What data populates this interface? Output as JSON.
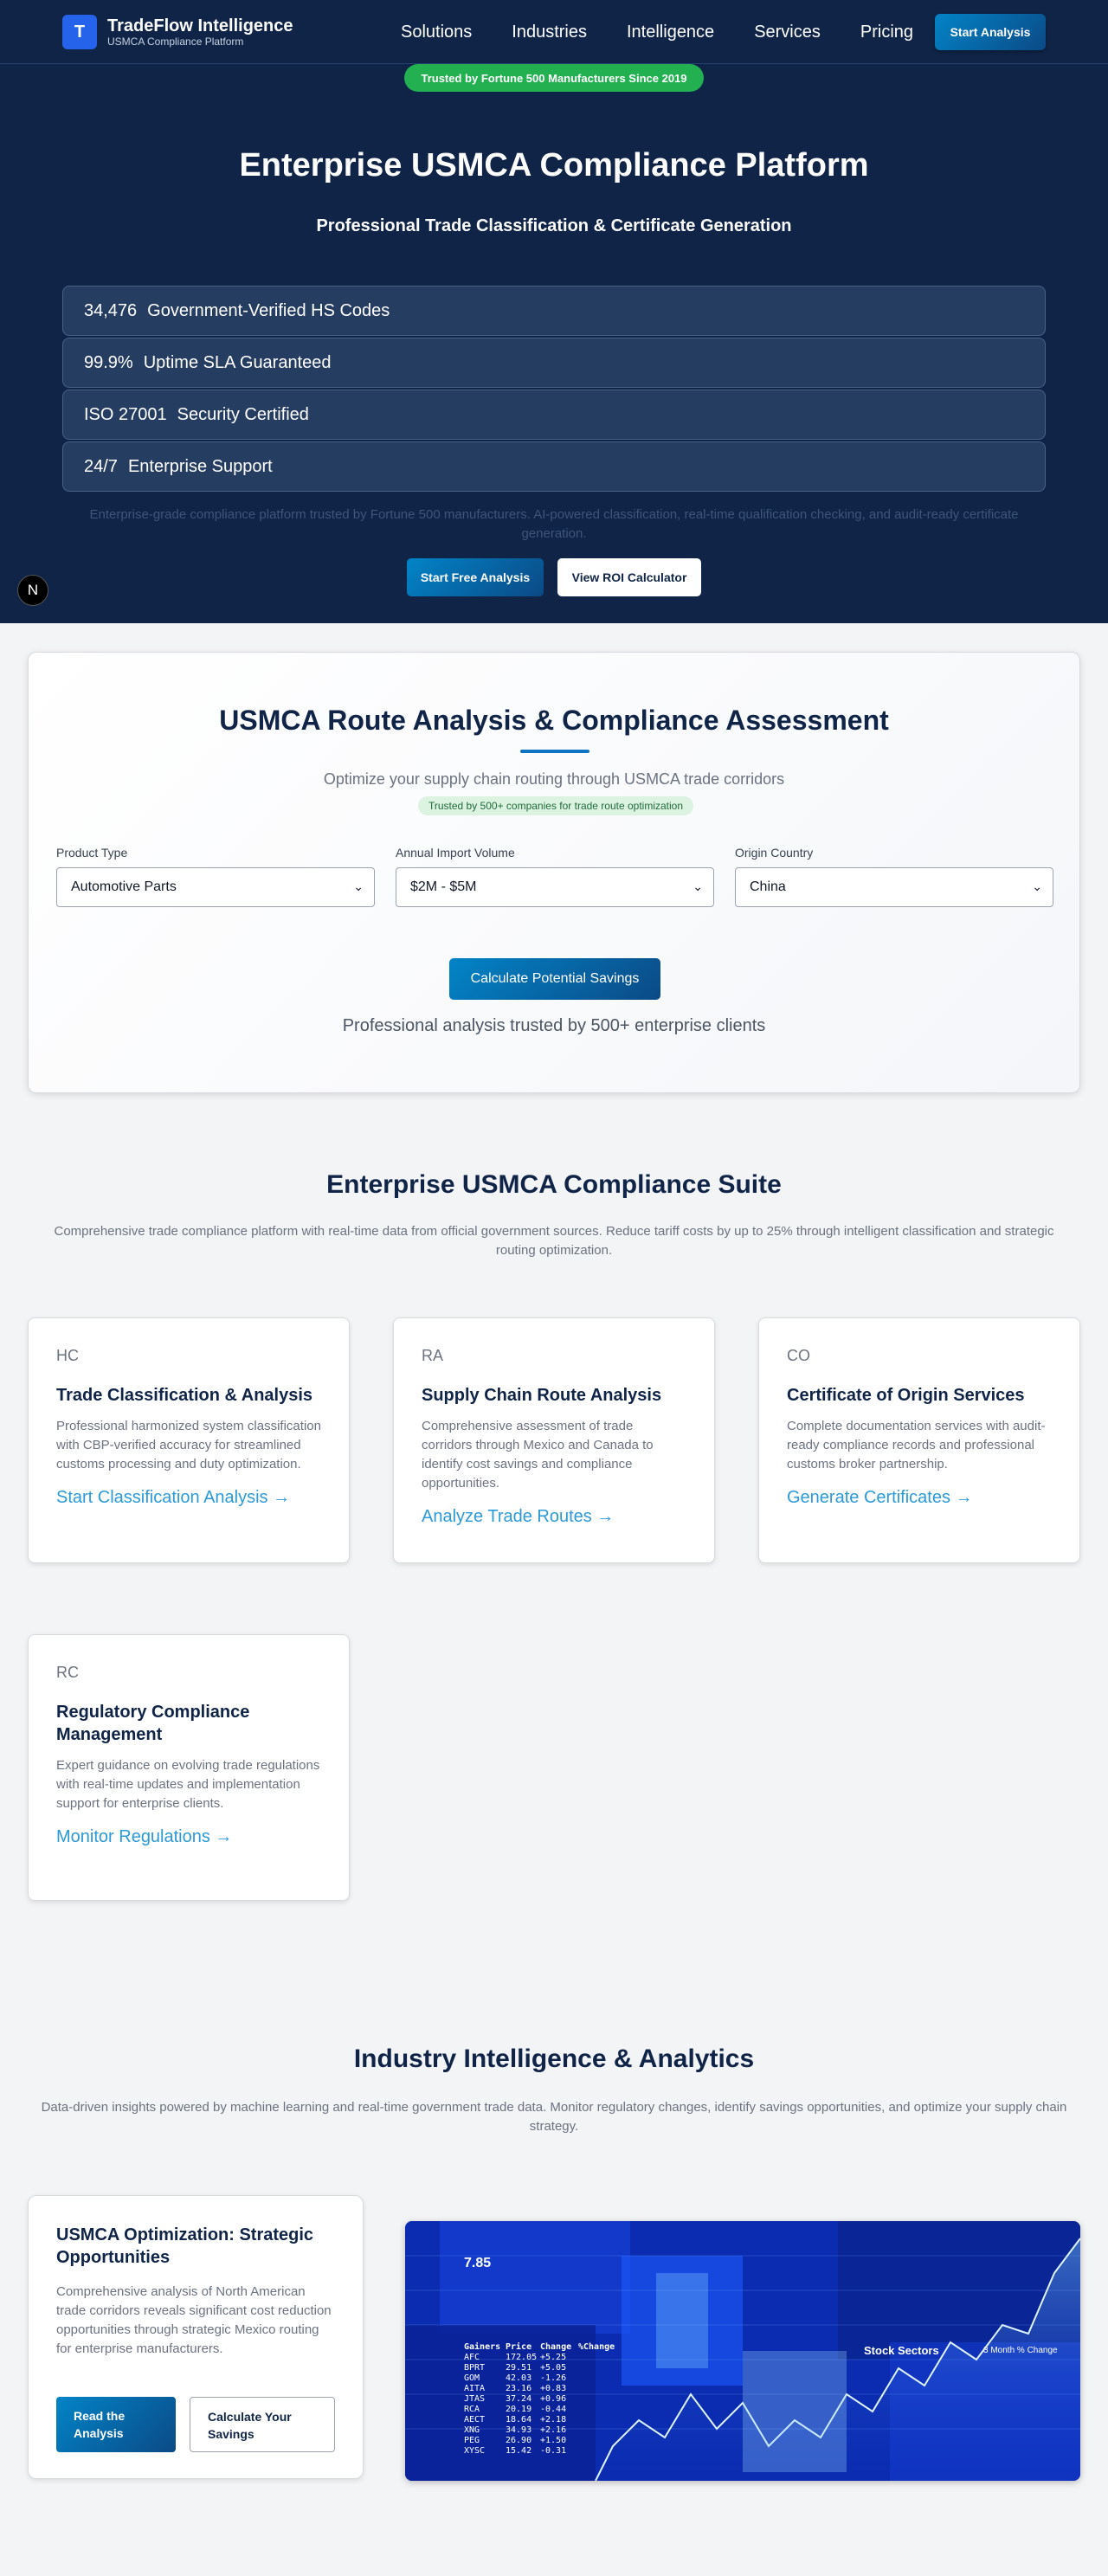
{
  "nav": {
    "brand_letter": "T",
    "brand_name": "TradeFlow Intelligence",
    "brand_sub": "USMCA Compliance Platform",
    "links": [
      "Solutions",
      "Industries",
      "Intelligence",
      "Services",
      "Pricing"
    ],
    "cta": "Start Analysis"
  },
  "hero": {
    "trust_badge": "Trusted by Fortune 500 Manufacturers Since 2019",
    "title": "Enterprise USMCA Compliance Platform",
    "subtitle": "Professional Trade Classification & Certificate Generation",
    "stats": [
      {
        "num": "34,476",
        "label": "Government-Verified HS Codes"
      },
      {
        "num": "99.9%",
        "label": "Uptime SLA Guaranteed"
      },
      {
        "num": "ISO 27001",
        "label": "Security Certified"
      },
      {
        "num": "24/7",
        "label": "Enterprise Support"
      }
    ],
    "description": "Enterprise-grade compliance platform trusted by Fortune 500 manufacturers. AI-powered classification, real-time qualification checking, and audit-ready certificate generation.",
    "primary_btn": "Start Free Analysis",
    "secondary_btn": "View ROI Calculator",
    "dev_badge": "N"
  },
  "route": {
    "title": "USMCA Route Analysis & Compliance Assessment",
    "subtitle": "Optimize your supply chain routing through USMCA trade corridors",
    "pill": "Trusted by 500+ companies for trade route optimization",
    "fields": [
      {
        "label": "Product Type",
        "value": "Automotive Parts"
      },
      {
        "label": "Annual Import Volume",
        "value": "$2M - $5M"
      },
      {
        "label": "Origin Country",
        "value": "China"
      }
    ],
    "button": "Calculate Potential Savings",
    "footer": "Professional analysis trusted by 500+ enterprise clients"
  },
  "suite": {
    "title": "Enterprise USMCA Compliance Suite",
    "description": "Comprehensive trade compliance platform with real-time data from official government sources. Reduce tariff costs by up to 25% through intelligent classification and strategic routing optimization.",
    "cards": [
      {
        "abbr": "HC",
        "name": "Trade Classification & Analysis",
        "desc": "Professional harmonized system classification with CBP-verified accuracy for streamlined customs processing and duty optimization.",
        "link": "Start Classification Analysis →"
      },
      {
        "abbr": "RA",
        "name": "Supply Chain Route Analysis",
        "desc": "Comprehensive assessment of trade corridors through Mexico and Canada to identify cost savings and compliance opportunities.",
        "link": "Analyze Trade Routes →"
      },
      {
        "abbr": "CO",
        "name": "Certificate of Origin Services",
        "desc": "Complete documentation services with audit-ready compliance records and professional customs broker partnership.",
        "link": "Generate Certificates →"
      },
      {
        "abbr": "RC",
        "name": "Regulatory Compliance Management",
        "desc": "Expert guidance on evolving trade regulations with real-time updates and implementation support for enterprise clients.",
        "link": "Monitor Regulations →"
      }
    ]
  },
  "intel": {
    "title": "Industry Intelligence & Analytics",
    "description": "Data-driven insights powered by machine learning and real-time government trade data. Monitor regulatory changes, identify savings opportunities, and optimize your supply chain strategy.",
    "article": {
      "title": "USMCA Optimization: Strategic Opportunities",
      "desc": "Comprehensive analysis of North American trade corridors reveals significant cost reduction opportunities through strategic Mexico routing for enterprise manufacturers.",
      "btn1": "Read the Analysis",
      "btn2": "Calculate Your Savings"
    },
    "market_image": {
      "ticker_table_header": [
        "Gainers",
        "Price",
        "Change",
        "%Change"
      ],
      "ticker_symbols": [
        "AFC",
        "BPRT",
        "GOM",
        "AITA",
        "JTAS",
        "RCA",
        "AECT",
        "XNG",
        "PEG",
        "XYSC"
      ],
      "ticker_prices": [
        "172.05",
        "29.51",
        "42.03",
        "23.16",
        "37.24",
        "20.19",
        "18.64",
        "34.93",
        "26.90",
        "15.42"
      ],
      "ticker_changes": [
        "+5.25",
        "+5.05",
        "-1.26",
        "+0.83",
        "+0.96",
        "-0.44",
        "+2.18",
        "+2.16",
        "+1.50",
        "-0.31"
      ],
      "big_value": "7.85",
      "panel_label": "Stock Sectors",
      "panel_range": "3 Month % Change"
    }
  }
}
